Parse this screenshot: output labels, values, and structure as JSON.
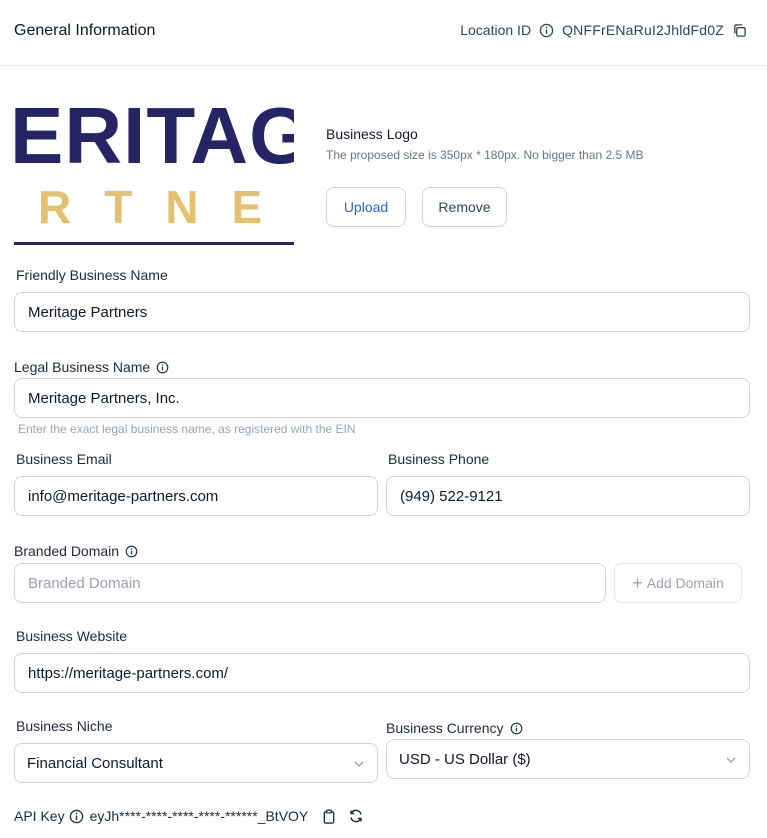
{
  "header": {
    "title": "General Information",
    "location_label": "Location ID",
    "location_id": "QNFFrENaRuI2JhldFd0Z"
  },
  "logo": {
    "text_top": "ERITAG",
    "text_bottom": "RTNE",
    "colors": {
      "navy": "#262465",
      "gold": "#e3c16f"
    },
    "title": "Business Logo",
    "hint": "The proposed size is 350px * 180px. No bigger than 2.5 MB",
    "upload_label": "Upload",
    "remove_label": "Remove"
  },
  "fields": {
    "friendly_name": {
      "label": "Friendly Business Name",
      "value": "Meritage Partners"
    },
    "legal_name": {
      "label": "Legal Business Name",
      "value": "Meritage Partners, Inc.",
      "help": "Enter the exact legal business name, as registered with the EIN"
    },
    "email": {
      "label": "Business Email",
      "value": "info@meritage-partners.com"
    },
    "phone": {
      "label": "Business Phone",
      "value": "(949) 522-9121"
    },
    "branded_domain": {
      "label": "Branded Domain",
      "placeholder": "Branded Domain",
      "add_label": "Add Domain"
    },
    "website": {
      "label": "Business Website",
      "value": "https://meritage-partners.com/"
    },
    "niche": {
      "label": "Business Niche",
      "value": "Financial Consultant"
    },
    "currency": {
      "label": "Business Currency",
      "value": "USD - US Dollar ($)"
    }
  },
  "api": {
    "label": "API Key",
    "value": "eyJh****-****-****-****-******_BtVOY"
  },
  "icons": [
    "info-icon",
    "copy-icon",
    "clipboard-icon",
    "refresh-icon",
    "chevron-down-icon",
    "plus-icon"
  ],
  "colors": {
    "accent": "#2563eb",
    "border": "#d1d5db",
    "muted": "#9ca3af"
  }
}
